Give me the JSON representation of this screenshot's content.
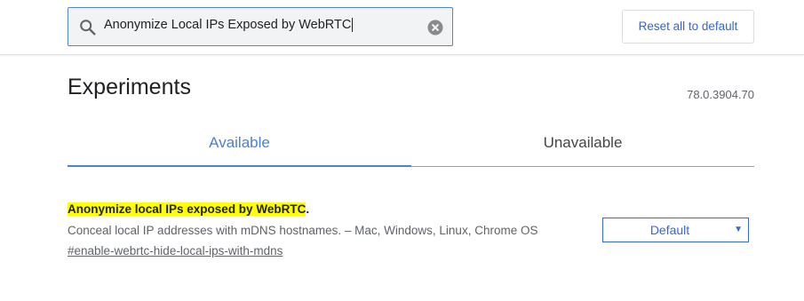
{
  "search": {
    "value": "Anonymize Local IPs Exposed by WebRTC",
    "search_icon": "search-icon",
    "clear_icon": "clear-icon"
  },
  "header": {
    "reset_label": "Reset all to default"
  },
  "main": {
    "title": "Experiments",
    "version": "78.0.3904.70",
    "tabs": [
      {
        "label": "Available",
        "active": true
      },
      {
        "label": "Unavailable",
        "active": false
      }
    ]
  },
  "experiment": {
    "title": "Anonymize local IPs exposed by WebRTC",
    "title_suffix": ".",
    "description": "Conceal local IP addresses with mDNS hostnames. – Mac, Windows, Linux, Chrome OS",
    "link": "#enable-webrtc-hide-local-ips-with-mdns",
    "select_value": "Default",
    "select_arrow": "▼"
  },
  "colors": {
    "accent": "#4a80d6",
    "highlight": "#ffff00",
    "search_border": "#4d88d6"
  }
}
